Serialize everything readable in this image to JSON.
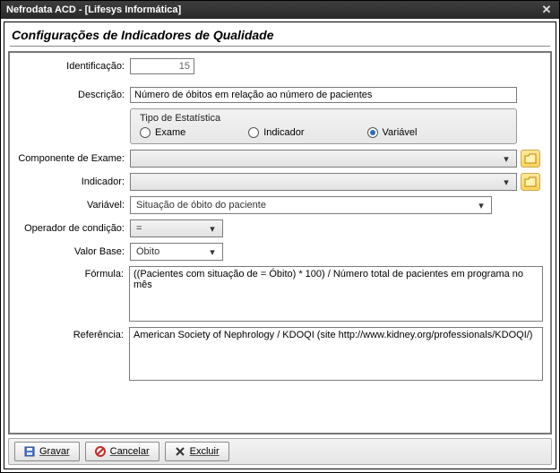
{
  "window": {
    "title": "Nefrodata ACD - [Lifesys Informática]"
  },
  "panel": {
    "title": "Configurações de Indicadores de Qualidade"
  },
  "labels": {
    "identificacao": "Identificação:",
    "descricao": "Descrição:",
    "tipo_estatistica": "Tipo de Estatística",
    "componente_exame": "Componente de Exame:",
    "indicador": "Indicador:",
    "variavel": "Variável:",
    "operador_condicao": "Operador de condição:",
    "valor_base": "Valor Base:",
    "formula": "Fórmula:",
    "referencia": "Referência:"
  },
  "values": {
    "identificacao": "15",
    "descricao": "Número de óbitos em relação ao número de pacientes",
    "componente_exame": "",
    "indicador": "",
    "variavel": "Situação de óbito do paciente",
    "operador": "=",
    "valor_base": "Óbito",
    "formula": "((Pacientes com situação de = Óbito) * 100) / Número total de pacientes em programa no mês",
    "referencia": "American Society of Nephrology / KDOQI (site http://www.kidney.org/professionals/KDOQI/)"
  },
  "radios": {
    "exame": "Exame",
    "indicador": "Indicador",
    "variavel": "Variável",
    "selected": "variavel"
  },
  "buttons": {
    "gravar": "Gravar",
    "cancelar": "Cancelar",
    "excluir": "Excluir"
  }
}
